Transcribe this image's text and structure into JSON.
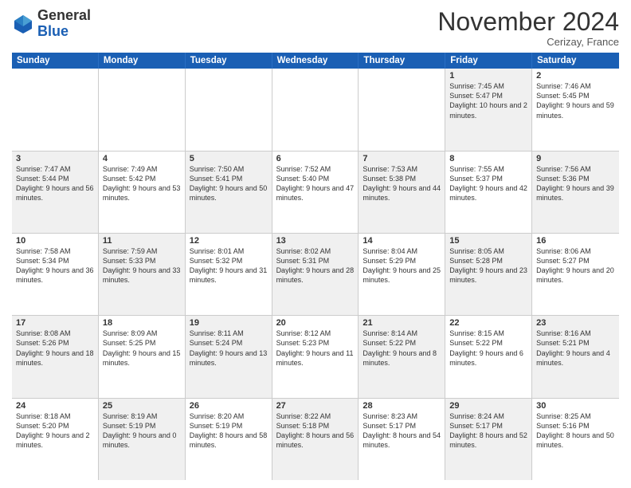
{
  "logo": {
    "line1": "General",
    "line2": "Blue"
  },
  "title": "November 2024",
  "location": "Cerizay, France",
  "header_days": [
    "Sunday",
    "Monday",
    "Tuesday",
    "Wednesday",
    "Thursday",
    "Friday",
    "Saturday"
  ],
  "weeks": [
    [
      {
        "day": "",
        "text": "",
        "shaded": false,
        "empty": true
      },
      {
        "day": "",
        "text": "",
        "shaded": false,
        "empty": true
      },
      {
        "day": "",
        "text": "",
        "shaded": false,
        "empty": true
      },
      {
        "day": "",
        "text": "",
        "shaded": false,
        "empty": true
      },
      {
        "day": "",
        "text": "",
        "shaded": false,
        "empty": true
      },
      {
        "day": "1",
        "text": "Sunrise: 7:45 AM\nSunset: 5:47 PM\nDaylight: 10 hours and 2 minutes.",
        "shaded": true,
        "empty": false
      },
      {
        "day": "2",
        "text": "Sunrise: 7:46 AM\nSunset: 5:45 PM\nDaylight: 9 hours and 59 minutes.",
        "shaded": false,
        "empty": false
      }
    ],
    [
      {
        "day": "3",
        "text": "Sunrise: 7:47 AM\nSunset: 5:44 PM\nDaylight: 9 hours and 56 minutes.",
        "shaded": true,
        "empty": false
      },
      {
        "day": "4",
        "text": "Sunrise: 7:49 AM\nSunset: 5:42 PM\nDaylight: 9 hours and 53 minutes.",
        "shaded": false,
        "empty": false
      },
      {
        "day": "5",
        "text": "Sunrise: 7:50 AM\nSunset: 5:41 PM\nDaylight: 9 hours and 50 minutes.",
        "shaded": true,
        "empty": false
      },
      {
        "day": "6",
        "text": "Sunrise: 7:52 AM\nSunset: 5:40 PM\nDaylight: 9 hours and 47 minutes.",
        "shaded": false,
        "empty": false
      },
      {
        "day": "7",
        "text": "Sunrise: 7:53 AM\nSunset: 5:38 PM\nDaylight: 9 hours and 44 minutes.",
        "shaded": true,
        "empty": false
      },
      {
        "day": "8",
        "text": "Sunrise: 7:55 AM\nSunset: 5:37 PM\nDaylight: 9 hours and 42 minutes.",
        "shaded": false,
        "empty": false
      },
      {
        "day": "9",
        "text": "Sunrise: 7:56 AM\nSunset: 5:36 PM\nDaylight: 9 hours and 39 minutes.",
        "shaded": true,
        "empty": false
      }
    ],
    [
      {
        "day": "10",
        "text": "Sunrise: 7:58 AM\nSunset: 5:34 PM\nDaylight: 9 hours and 36 minutes.",
        "shaded": false,
        "empty": false
      },
      {
        "day": "11",
        "text": "Sunrise: 7:59 AM\nSunset: 5:33 PM\nDaylight: 9 hours and 33 minutes.",
        "shaded": true,
        "empty": false
      },
      {
        "day": "12",
        "text": "Sunrise: 8:01 AM\nSunset: 5:32 PM\nDaylight: 9 hours and 31 minutes.",
        "shaded": false,
        "empty": false
      },
      {
        "day": "13",
        "text": "Sunrise: 8:02 AM\nSunset: 5:31 PM\nDaylight: 9 hours and 28 minutes.",
        "shaded": true,
        "empty": false
      },
      {
        "day": "14",
        "text": "Sunrise: 8:04 AM\nSunset: 5:29 PM\nDaylight: 9 hours and 25 minutes.",
        "shaded": false,
        "empty": false
      },
      {
        "day": "15",
        "text": "Sunrise: 8:05 AM\nSunset: 5:28 PM\nDaylight: 9 hours and 23 minutes.",
        "shaded": true,
        "empty": false
      },
      {
        "day": "16",
        "text": "Sunrise: 8:06 AM\nSunset: 5:27 PM\nDaylight: 9 hours and 20 minutes.",
        "shaded": false,
        "empty": false
      }
    ],
    [
      {
        "day": "17",
        "text": "Sunrise: 8:08 AM\nSunset: 5:26 PM\nDaylight: 9 hours and 18 minutes.",
        "shaded": true,
        "empty": false
      },
      {
        "day": "18",
        "text": "Sunrise: 8:09 AM\nSunset: 5:25 PM\nDaylight: 9 hours and 15 minutes.",
        "shaded": false,
        "empty": false
      },
      {
        "day": "19",
        "text": "Sunrise: 8:11 AM\nSunset: 5:24 PM\nDaylight: 9 hours and 13 minutes.",
        "shaded": true,
        "empty": false
      },
      {
        "day": "20",
        "text": "Sunrise: 8:12 AM\nSunset: 5:23 PM\nDaylight: 9 hours and 11 minutes.",
        "shaded": false,
        "empty": false
      },
      {
        "day": "21",
        "text": "Sunrise: 8:14 AM\nSunset: 5:22 PM\nDaylight: 9 hours and 8 minutes.",
        "shaded": true,
        "empty": false
      },
      {
        "day": "22",
        "text": "Sunrise: 8:15 AM\nSunset: 5:22 PM\nDaylight: 9 hours and 6 minutes.",
        "shaded": false,
        "empty": false
      },
      {
        "day": "23",
        "text": "Sunrise: 8:16 AM\nSunset: 5:21 PM\nDaylight: 9 hours and 4 minutes.",
        "shaded": true,
        "empty": false
      }
    ],
    [
      {
        "day": "24",
        "text": "Sunrise: 8:18 AM\nSunset: 5:20 PM\nDaylight: 9 hours and 2 minutes.",
        "shaded": false,
        "empty": false
      },
      {
        "day": "25",
        "text": "Sunrise: 8:19 AM\nSunset: 5:19 PM\nDaylight: 9 hours and 0 minutes.",
        "shaded": true,
        "empty": false
      },
      {
        "day": "26",
        "text": "Sunrise: 8:20 AM\nSunset: 5:19 PM\nDaylight: 8 hours and 58 minutes.",
        "shaded": false,
        "empty": false
      },
      {
        "day": "27",
        "text": "Sunrise: 8:22 AM\nSunset: 5:18 PM\nDaylight: 8 hours and 56 minutes.",
        "shaded": true,
        "empty": false
      },
      {
        "day": "28",
        "text": "Sunrise: 8:23 AM\nSunset: 5:17 PM\nDaylight: 8 hours and 54 minutes.",
        "shaded": false,
        "empty": false
      },
      {
        "day": "29",
        "text": "Sunrise: 8:24 AM\nSunset: 5:17 PM\nDaylight: 8 hours and 52 minutes.",
        "shaded": true,
        "empty": false
      },
      {
        "day": "30",
        "text": "Sunrise: 8:25 AM\nSunset: 5:16 PM\nDaylight: 8 hours and 50 minutes.",
        "shaded": false,
        "empty": false
      }
    ]
  ]
}
